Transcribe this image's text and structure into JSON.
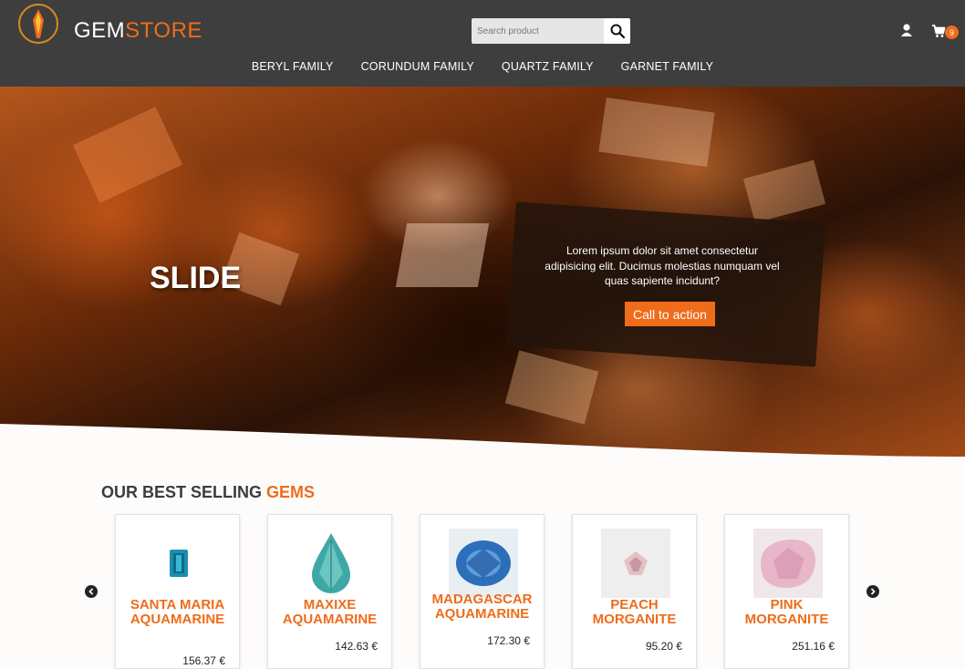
{
  "brand": {
    "part1": "GEM",
    "part2": "STORE"
  },
  "search": {
    "placeholder": "Search product"
  },
  "cart": {
    "count": "9"
  },
  "nav": [
    {
      "label": "BERYL FAMILY"
    },
    {
      "label": "CORUNDUM FAMILY"
    },
    {
      "label": "QUARTZ FAMILY"
    },
    {
      "label": "GARNET FAMILY"
    }
  ],
  "hero": {
    "title": "SLIDE",
    "text": "Lorem ipsum dolor sit amet consectetur adipisicing elit. Ducimus molestias numquam vel quas sapiente incidunt?",
    "cta": "Call to action"
  },
  "best": {
    "title_part1": "OUR BEST SELLING ",
    "title_part2": "GEMS"
  },
  "products": [
    {
      "name": "SANTA MARIA AQUAMARINE",
      "price": "156.37 €"
    },
    {
      "name": "MAXIXE AQUAMARINE",
      "price": "142.63 €"
    },
    {
      "name": "MADAGASCAR AQUAMARINE",
      "price": "172.30 €"
    },
    {
      "name": "PEACH MORGANITE",
      "price": "95.20 €"
    },
    {
      "name": "PINK MORGANITE",
      "price": "251.16 €"
    }
  ],
  "colors": {
    "accent": "#ef6c1a",
    "header": "#3e3e3e"
  },
  "icons": {
    "search": "search-icon",
    "user": "user-icon",
    "cart": "cart-icon",
    "prev": "chevron-left-icon",
    "next": "chevron-right-icon"
  }
}
